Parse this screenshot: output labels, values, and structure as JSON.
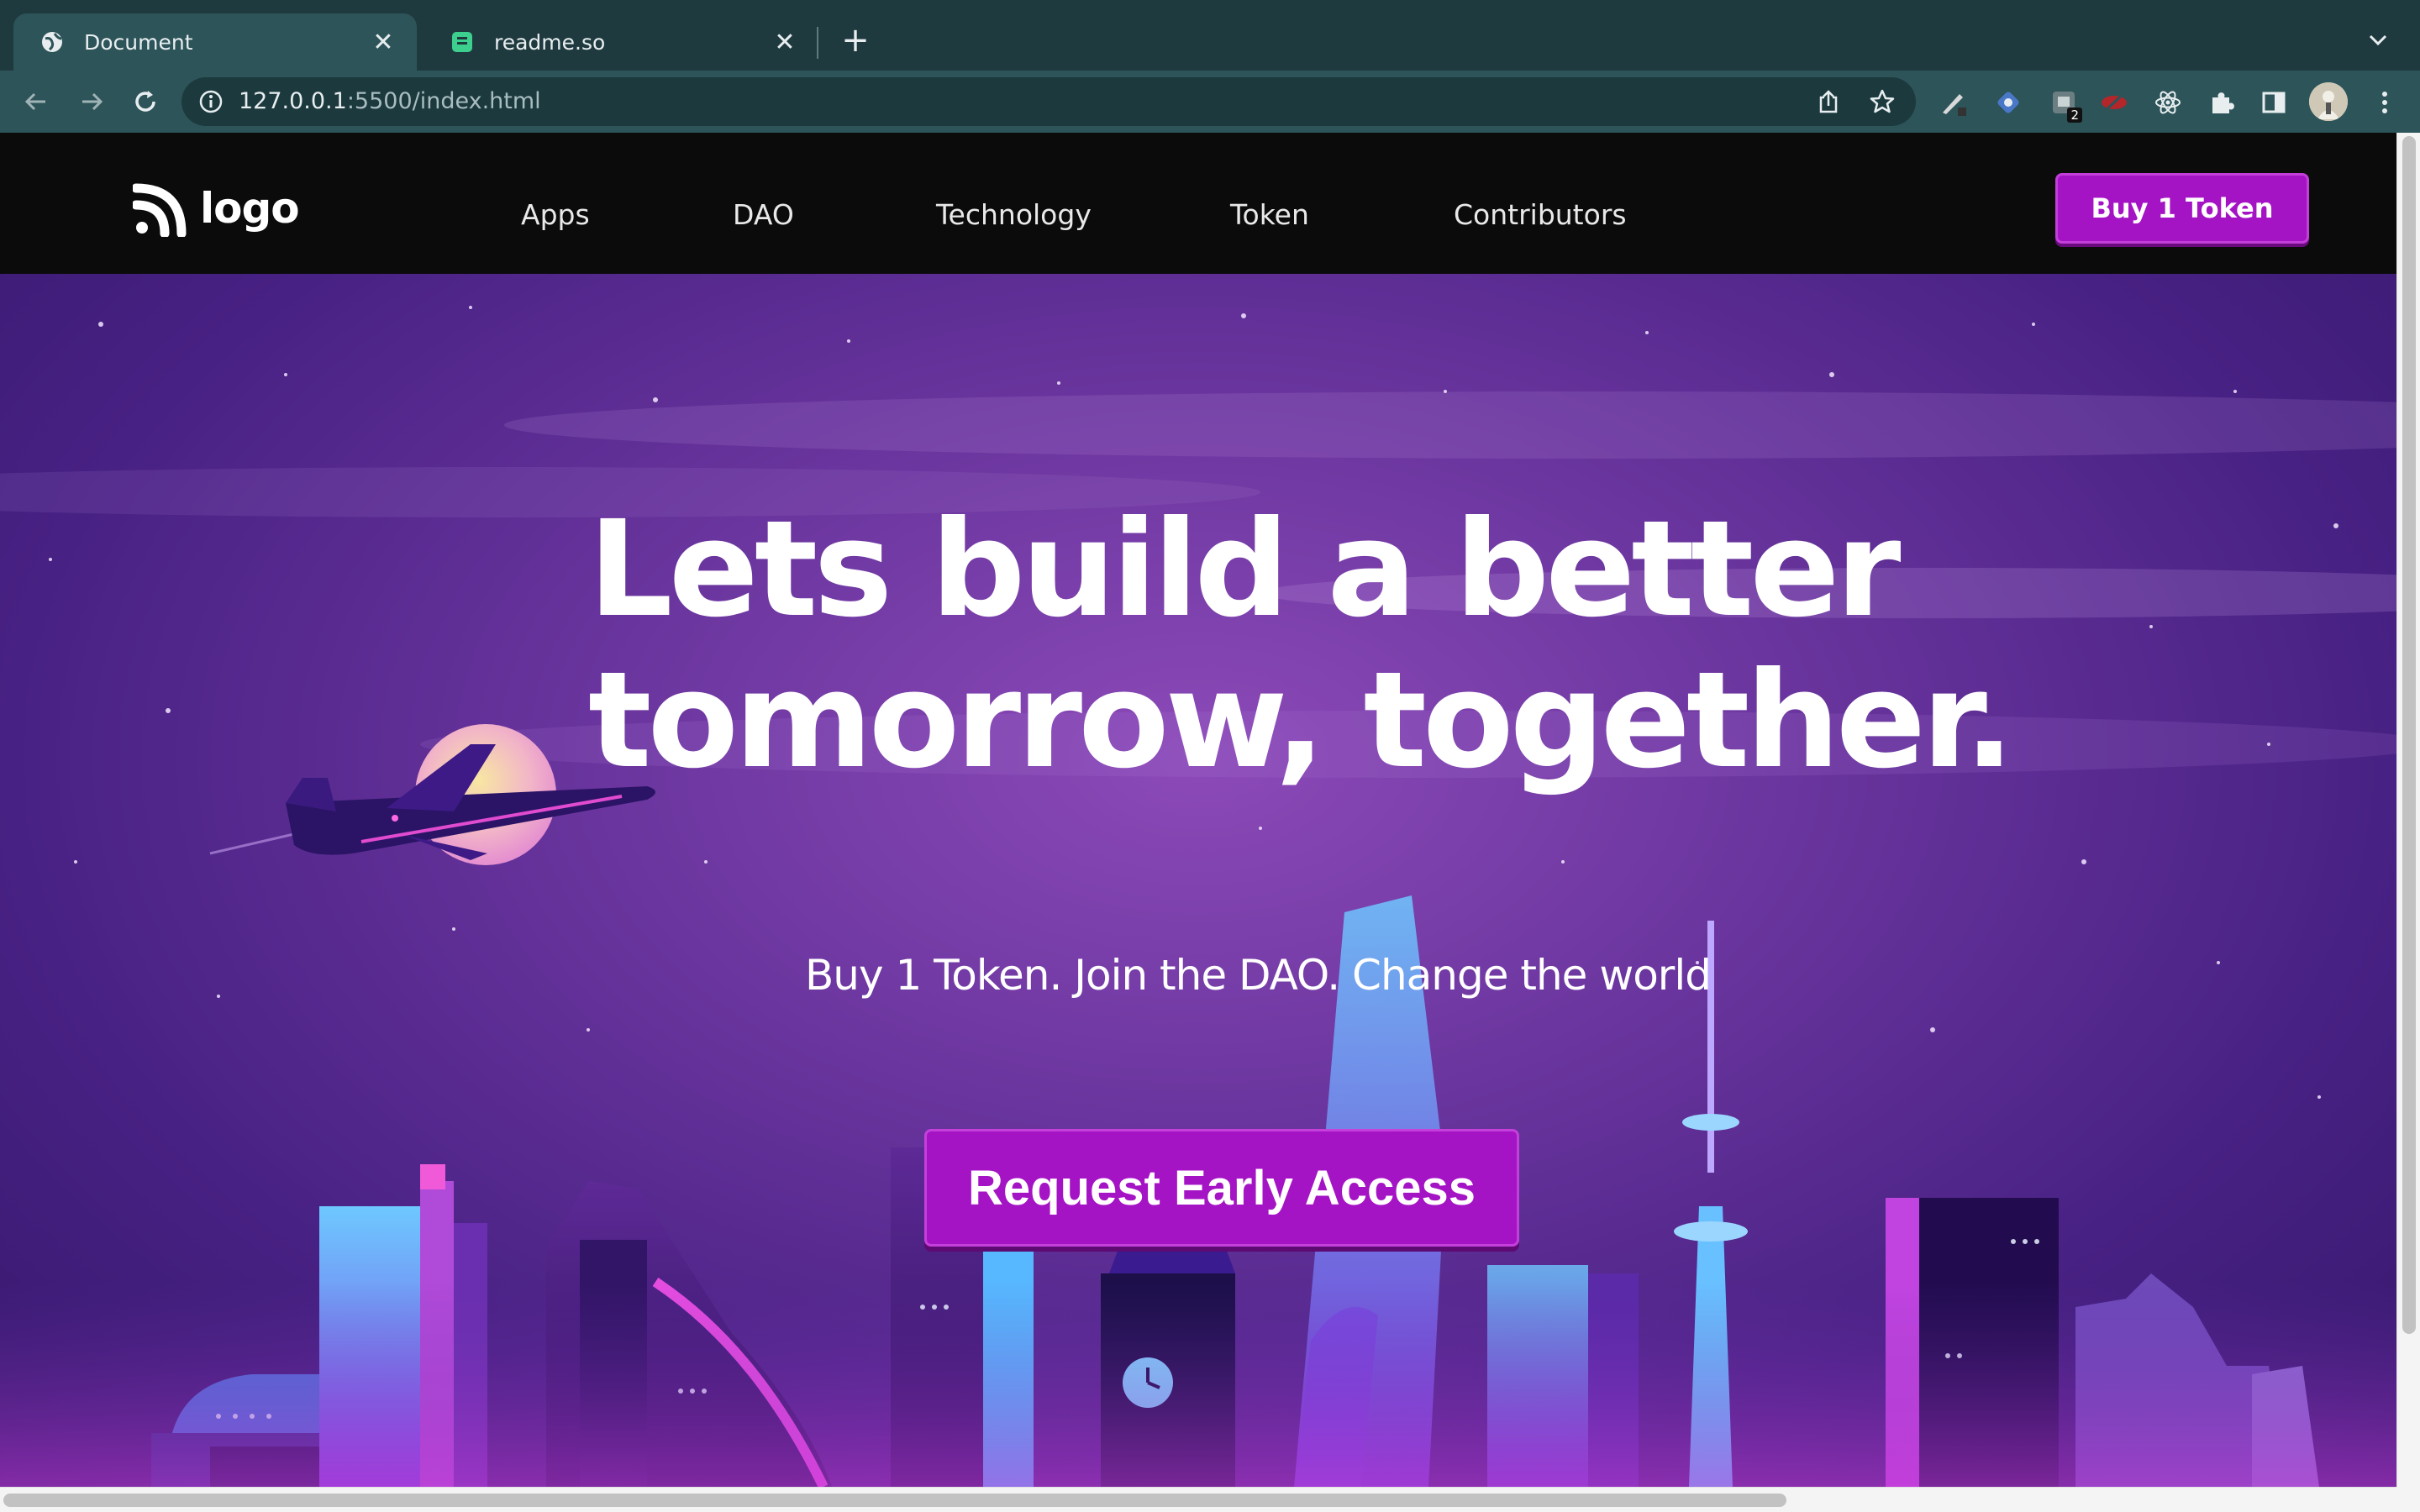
{
  "browser": {
    "tabs": [
      {
        "title": "Document",
        "active": true
      },
      {
        "title": "readme.so",
        "active": false
      }
    ],
    "url_host": "127.0.0.1",
    "url_rest": ":5500/index.html",
    "extension_badge": "2"
  },
  "site": {
    "logo_text": "logo",
    "nav": [
      "Apps",
      "DAO",
      "Technology",
      "Token",
      "Contributors"
    ],
    "buy_button": "Buy 1 Token"
  },
  "hero": {
    "headline_line1": "Lets build a better",
    "headline_line2": "tomorrow, together.",
    "tagline": "Buy 1 Token. Join the DAO. Change the world",
    "cta": "Request Early Access"
  },
  "colors": {
    "accent": "#a514c4",
    "nav_bg": "#0b0b0c",
    "chrome_tabstrip": "#1f3a3f",
    "chrome_toolbar": "#2d5459"
  }
}
